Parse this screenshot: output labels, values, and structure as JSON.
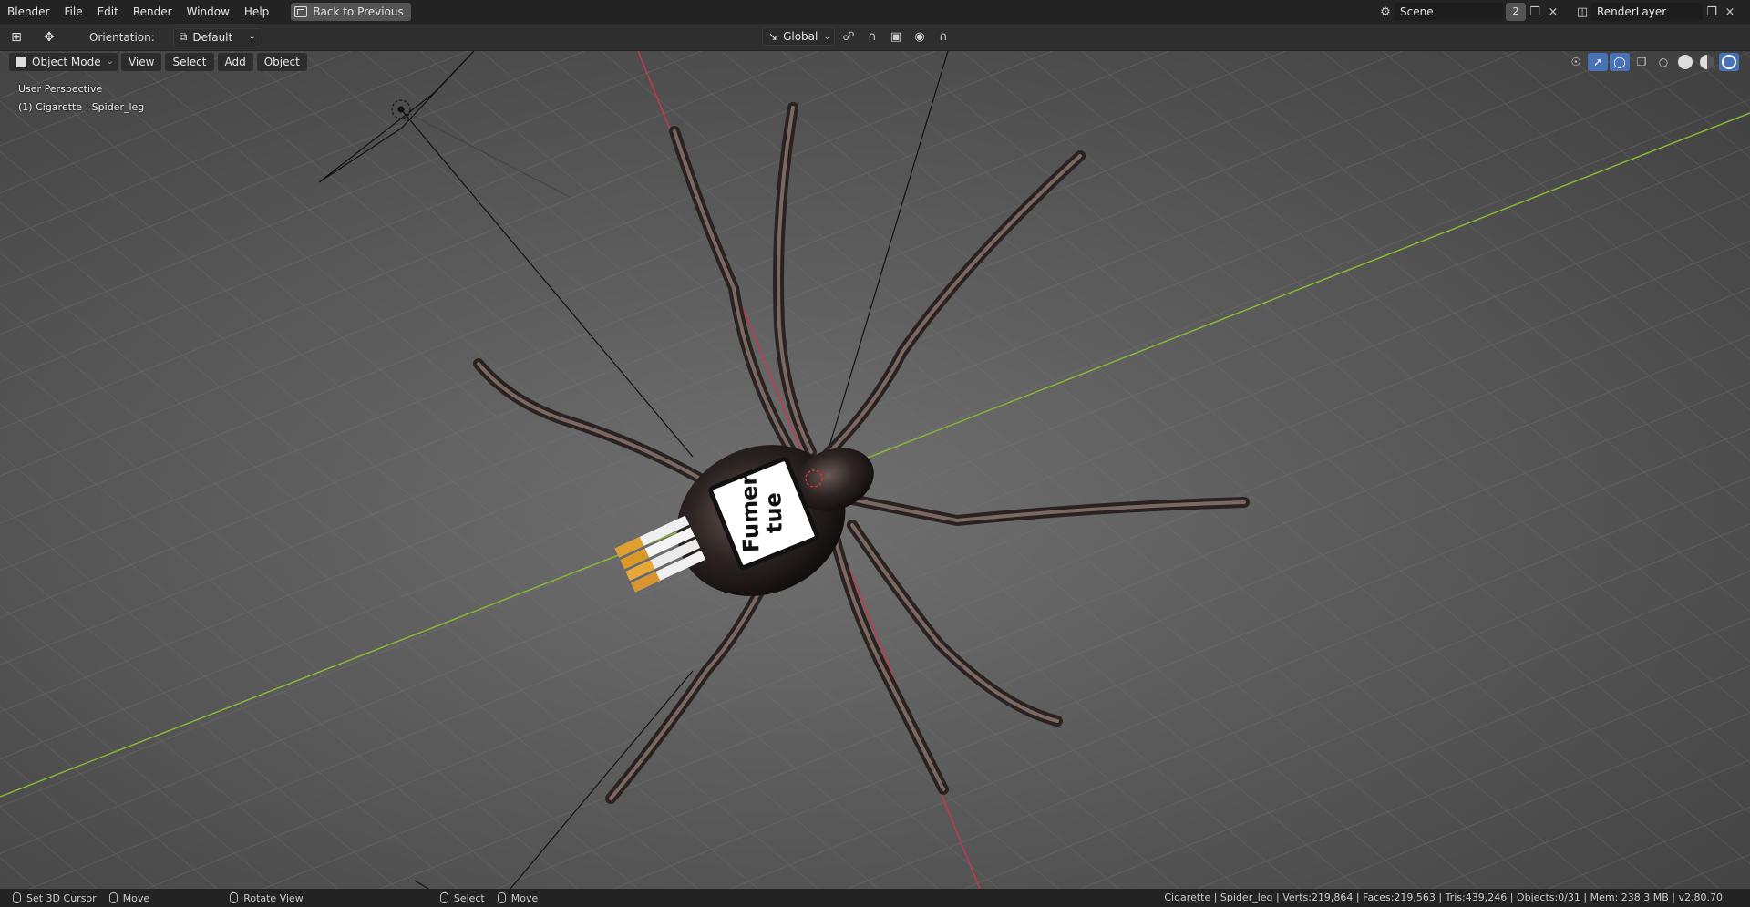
{
  "menu": [
    "Blender",
    "File",
    "Edit",
    "Render",
    "Window",
    "Help"
  ],
  "back_button": "Back to Previous",
  "scene": {
    "name": "Scene",
    "users": "2"
  },
  "render_layer": "RenderLayer",
  "header": {
    "orientation_label": "Orientation:",
    "orientation_value": "Default",
    "transform_orientation": "Global"
  },
  "viewport_header": {
    "mode": "Object Mode",
    "menus": [
      "View",
      "Select",
      "Add",
      "Object"
    ]
  },
  "viewport_info": {
    "perspective": "User Perspective",
    "active": "(1) Cigarette | Spider_leg"
  },
  "label_text": [
    "Fumer",
    "tue"
  ],
  "status_bar": {
    "items": [
      "Set 3D Cursor",
      "Move",
      "Rotate View",
      "Select",
      "Move"
    ],
    "stats": "Cigarette | Spider_leg | Verts:219,864 | Faces:219,563 | Tris:439,246 | Objects:0/31 | Mem: 238.3 MB | v2.80.70"
  },
  "colors": {
    "x_axis": "#c8384a",
    "y_axis": "#88b833",
    "accent": "#4772b3"
  }
}
